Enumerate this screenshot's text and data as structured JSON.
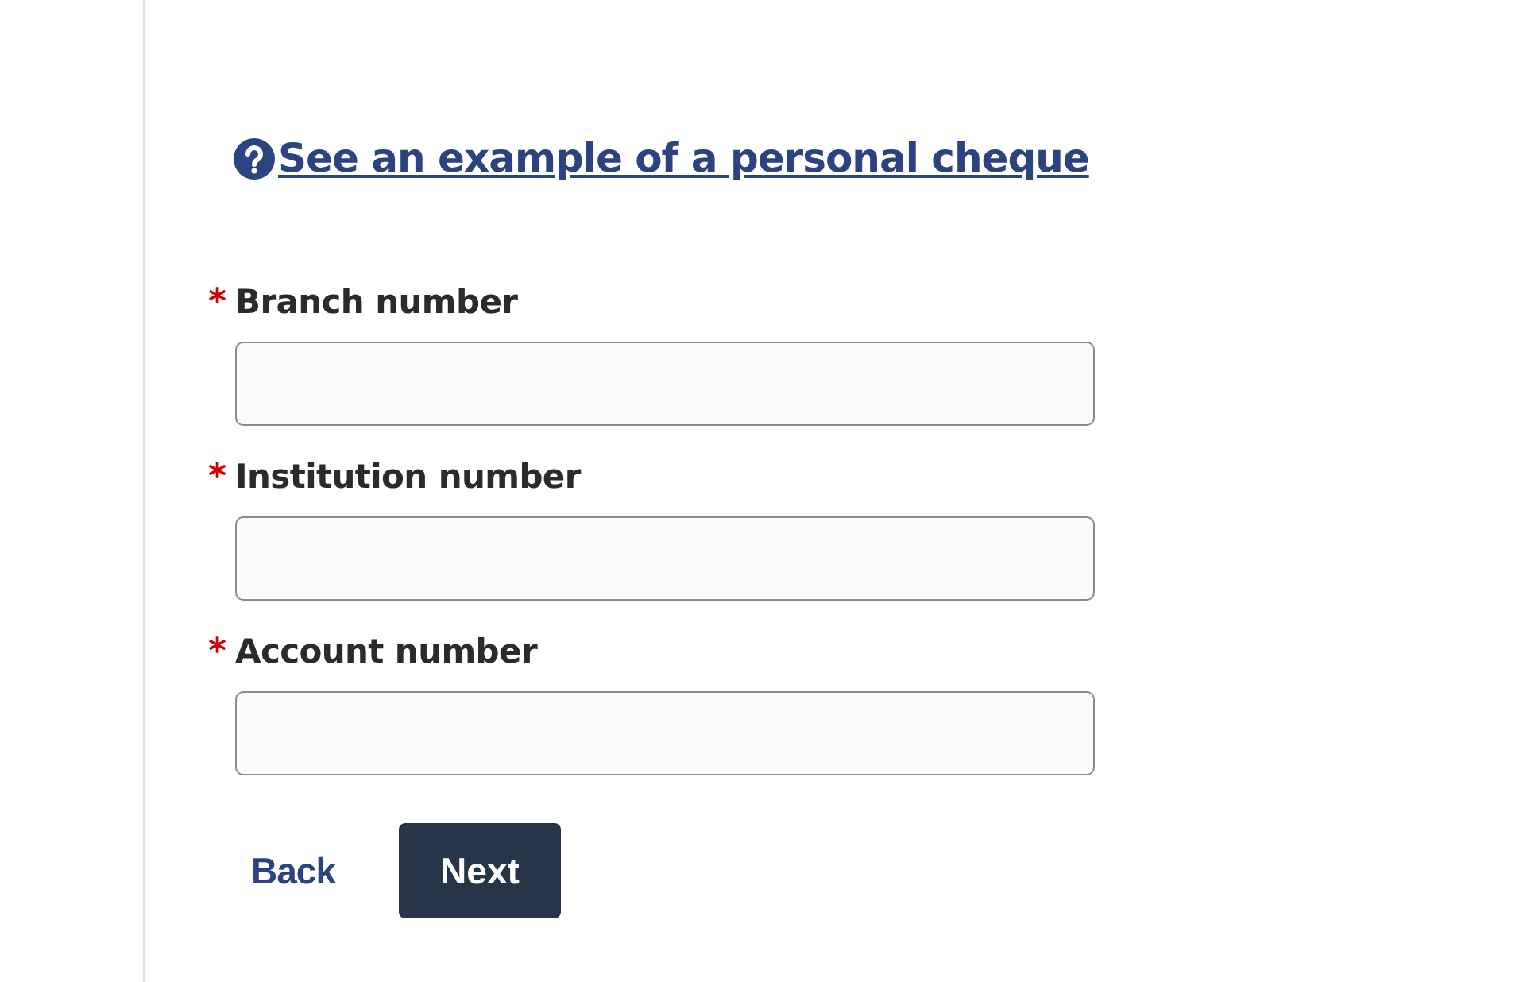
{
  "help_link": {
    "text": "See an example of a personal cheque"
  },
  "fields": [
    {
      "label": "Branch number",
      "required_mark": "*"
    },
    {
      "label": "Institution number",
      "required_mark": "*"
    },
    {
      "label": "Account number",
      "required_mark": "*"
    }
  ],
  "buttons": {
    "back": "Back",
    "next": "Next"
  }
}
